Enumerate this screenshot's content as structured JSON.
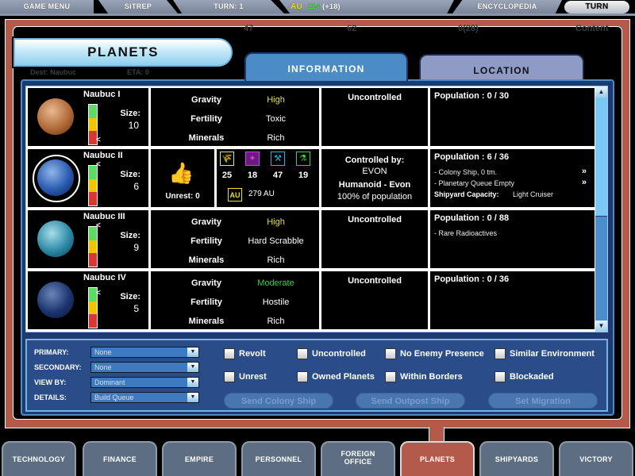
{
  "topbar": {
    "game_menu": "GAME MENU",
    "sitrep": "SITREP",
    "turn": "TURN: 1",
    "credits_icon": "AU",
    "credits_value": "114",
    "credits_delta": "(+18)",
    "encyclopedia": "ENCYCLOPEDIA",
    "turn_button": "TURN"
  },
  "background_ghost": {
    "stat1": "47",
    "stat2": "62",
    "stat3": "0(28)",
    "stat4": "Content",
    "dest": "Dest: Naubuc",
    "eta": "ETA: 0"
  },
  "header": {
    "title": "PLANETS"
  },
  "tabs": [
    {
      "label": "INFORMATION",
      "active": true
    },
    {
      "label": "LOCATION",
      "active": false
    }
  ],
  "planets": [
    {
      "name": "Naubuc I",
      "size_label": "Size:",
      "size": "10",
      "gauge_level": "low",
      "gravity_label": "Gravity",
      "gravity": "High",
      "gravity_color": "#e8e020",
      "fertility_label": "Fertility",
      "fertility": "Toxic",
      "minerals_label": "Minerals",
      "minerals": "Rich",
      "status": "Uncontrolled",
      "population": "Population : 0 / 30",
      "notes": []
    },
    {
      "name": "Naubuc II",
      "size_label": "Size:",
      "size": "6",
      "gauge_level": "high",
      "selected": true,
      "unrest_label": "Unrest: 0",
      "resources": [
        {
          "icon": "food-icon",
          "value": "25",
          "color": "#e8e090"
        },
        {
          "icon": "industry-icon",
          "value": "18",
          "color": "#d040e0"
        },
        {
          "icon": "mining-icon",
          "value": "47",
          "color": "#30b0e0"
        },
        {
          "icon": "research-icon",
          "value": "19",
          "color": "#35d435"
        }
      ],
      "income": "279 AU",
      "controlled_label": "Controlled by:",
      "controller": "EVON",
      "race": "Humanoid - Evon",
      "race_share": "100% of population",
      "population": "Population : 6 / 36",
      "notes": [
        "- Colony Ship, 0 tm.",
        "- Planetary Queue Empty"
      ],
      "note_arrow": "»",
      "shipyard_label": "Shipyard Capacity:",
      "shipyard_value": "Light Cruiser"
    },
    {
      "name": "Naubuc III",
      "size_label": "Size:",
      "size": "9",
      "gauge_level": "high",
      "gravity_label": "Gravity",
      "gravity": "High",
      "gravity_color": "#e8e020",
      "fertility_label": "Fertility",
      "fertility": "Hard Scrabble",
      "minerals_label": "Minerals",
      "minerals": "Rich",
      "status": "Uncontrolled",
      "population": "Population : 0 / 88",
      "notes": [
        "- Rare Radioactives"
      ]
    },
    {
      "name": "Naubuc IV",
      "size_label": "Size:",
      "size": "5",
      "gauge_level": "high",
      "gravity_label": "Gravity",
      "gravity": "Moderate",
      "gravity_color": "#35d435",
      "fertility_label": "Fertility",
      "fertility": "Hostile",
      "minerals_label": "Minerals",
      "minerals": "Rich",
      "status": "Uncontrolled",
      "population": "Population : 0 / 36",
      "notes": []
    }
  ],
  "filters": {
    "dropdowns": [
      {
        "label": "PRIMARY:",
        "value": "None"
      },
      {
        "label": "SECONDARY:",
        "value": "None"
      },
      {
        "label": "VIEW BY:",
        "value": "Dominant"
      },
      {
        "label": "DETAILS:",
        "value": "Build Queue"
      }
    ],
    "checkboxes": [
      {
        "label": "Revolt",
        "checked": false
      },
      {
        "label": "Uncontrolled",
        "checked": false
      },
      {
        "label": "No Enemy Presence",
        "checked": false
      },
      {
        "label": "Similar Environment",
        "checked": false
      },
      {
        "label": "Unrest",
        "checked": false
      },
      {
        "label": "Owned Planets",
        "checked": false
      },
      {
        "label": "Within Borders",
        "checked": false
      },
      {
        "label": "Blockaded",
        "checked": false
      }
    ],
    "actions": [
      {
        "label": "Send Colony Ship",
        "enabled": false
      },
      {
        "label": "Send Outpost Ship",
        "enabled": false
      },
      {
        "label": "Set Migration",
        "enabled": false
      }
    ]
  },
  "bottom_nav": [
    {
      "label": "TECHNOLOGY"
    },
    {
      "label": "FINANCE"
    },
    {
      "label": "EMPIRE"
    },
    {
      "label": "PERSONNEL"
    },
    {
      "label": "FOREIGN OFFICE"
    },
    {
      "label": "PLANETS",
      "active": true
    },
    {
      "label": "SHIPYARDS"
    },
    {
      "label": "VICTORY"
    }
  ]
}
